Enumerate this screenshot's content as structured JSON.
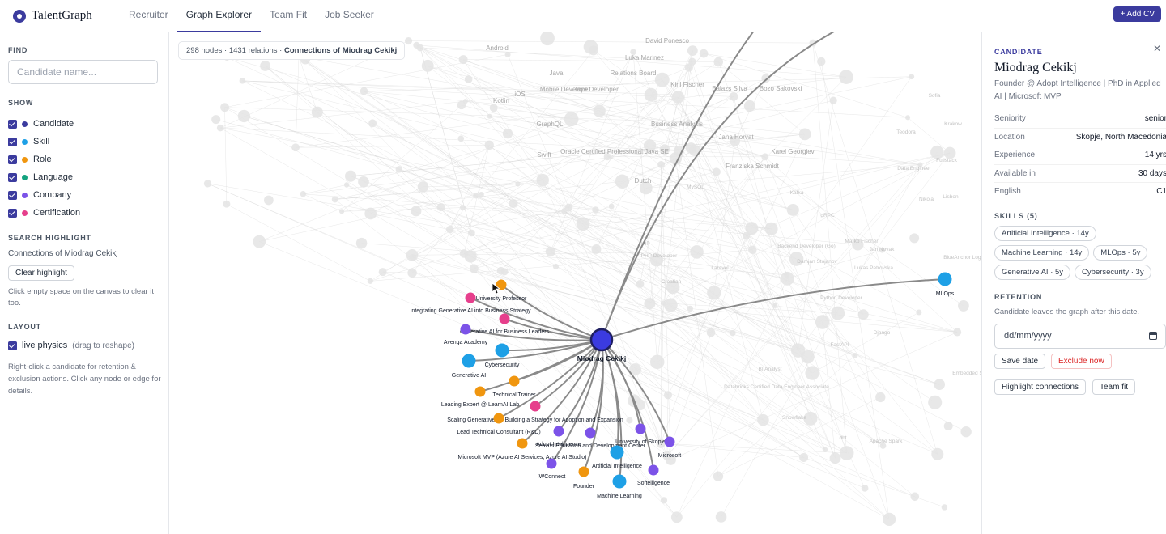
{
  "app": {
    "name": "TalentGraph"
  },
  "nav": {
    "tabs": [
      {
        "label": "Recruiter"
      },
      {
        "label": "Graph Explorer",
        "active": true
      },
      {
        "label": "Team Fit"
      },
      {
        "label": "Job Seeker"
      }
    ],
    "add_cv_label": "+ Add CV"
  },
  "sidebar": {
    "find_title": "FIND",
    "search_placeholder": "Candidate name...",
    "show_title": "SHOW",
    "filters": [
      {
        "label": "Candidate",
        "color": "#3b3b9e",
        "checked": true
      },
      {
        "label": "Skill",
        "color": "#1ea0e6",
        "checked": true
      },
      {
        "label": "Role",
        "color": "#f0960f",
        "checked": true
      },
      {
        "label": "Language",
        "color": "#14a37f",
        "checked": true
      },
      {
        "label": "Company",
        "color": "#7c53e8",
        "checked": true
      },
      {
        "label": "Certification",
        "color": "#e63f8c",
        "checked": true
      }
    ],
    "highlight_title": "SEARCH HIGHLIGHT",
    "highlight_text": "Connections of Miodrag Cekikj",
    "clear_label": "Clear highlight",
    "clear_hint": "Click empty space on the canvas to clear it too.",
    "layout_title": "LAYOUT",
    "physics_label": "live physics",
    "physics_hint": "(drag to reshape)",
    "help_text": "Right-click a candidate for retention & exclusion actions. Click any node or edge for details."
  },
  "canvas": {
    "stats_prefix": "298 nodes · 1431 relations · ",
    "stats_focus": "Connections of Miodrag Cekikj",
    "center": {
      "label": "Miodrag Cekikj"
    },
    "nodes": [
      {
        "label": "University Professor",
        "type": "role"
      },
      {
        "label": "Integrating Generative AI into Business Strategy",
        "type": "certification"
      },
      {
        "label": "Generative AI for Business Leaders",
        "type": "certification"
      },
      {
        "label": "Avenga Academy",
        "type": "company"
      },
      {
        "label": "Cybersecurity",
        "type": "skill"
      },
      {
        "label": "Generative AI",
        "type": "skill"
      },
      {
        "label": "Technical Trainer",
        "type": "role"
      },
      {
        "label": "Leading Expert @ LearnAI Lab",
        "type": "role"
      },
      {
        "label": "Scaling Generative AI: Building a Strategy for Adoption and Expansion",
        "type": "certification"
      },
      {
        "label": "Lead Technical Consultant (R&D)",
        "type": "role"
      },
      {
        "label": "Adopt Intelligence",
        "type": "company"
      },
      {
        "label": "Seavus Education and Development Center",
        "type": "company"
      },
      {
        "label": "University of Skopje",
        "type": "company"
      },
      {
        "label": "Microsoft MVP (Azure AI Services, Azure AI Studio)",
        "type": "role"
      },
      {
        "label": "Artificial Intelligence",
        "type": "skill"
      },
      {
        "label": "Microsoft",
        "type": "company"
      },
      {
        "label": "IWConnect",
        "type": "company"
      },
      {
        "label": "Founder",
        "type": "role"
      },
      {
        "label": "Softelligence",
        "type": "company"
      },
      {
        "label": "Machine Learning",
        "type": "skill"
      },
      {
        "label": "MLOps",
        "type": "skill"
      }
    ],
    "faded_labels": [
      "Android",
      "Java",
      "Relations Board",
      "David Ponesco",
      "Luka Marinez",
      "iOS",
      "Mobile Developer",
      "Java Developer",
      "Kiril Fischer",
      "Balazs Silva",
      "Bozo Sakovski",
      "Kotlin",
      "GraphQL",
      "Business Analysis",
      "Jana Horvat",
      "Karel Georgiev",
      "Swift",
      "Oracle Certified Professional Java SE",
      "Franziska Schmidt",
      "Dutch",
      "MySQL",
      "Kafka",
      "PHP",
      "PHP Developer",
      "gRPC",
      "Marko Fischer",
      "Laravel",
      "Croatian",
      "Jan Novak",
      "Lukas Petrovska",
      "Damjan Stojanov",
      "Python Developer",
      "BlueAnchor Logistic",
      "Django",
      "FastAPI",
      "BI Analyst",
      "Databricks Certified Data Engineer Associate",
      "Snowflake",
      "dbt",
      "Apache Spark",
      "Embedded S",
      "Backend Developer (Go)",
      "Nikola",
      "Data Engineer",
      "Lisbon",
      "Fullstack",
      "Teodora",
      "Krakow",
      "Sofia"
    ]
  },
  "panel": {
    "kicker": "CANDIDATE",
    "name": "Miodrag Cekikj",
    "headline": "Founder @ Adopt Intelligence | PhD in Applied AI | Microsoft MVP",
    "facts": [
      {
        "key": "Seniority",
        "value": "senior"
      },
      {
        "key": "Location",
        "value": "Skopje, North Macedonia"
      },
      {
        "key": "Experience",
        "value": "14 yrs"
      },
      {
        "key": "Available in",
        "value": "30 days"
      },
      {
        "key": "English",
        "value": "C1"
      }
    ],
    "skills_title": "SKILLS (5)",
    "skills": [
      "Artificial Intelligence · 14y",
      "Machine Learning · 14y",
      "MLOps · 5y",
      "Generative AI · 5y",
      "Cybersecurity · 3y"
    ],
    "retention_title": "RETENTION",
    "retention_text": "Candidate leaves the graph after this date.",
    "date_placeholder": "dd/mm/yyyy",
    "save_label": "Save date",
    "exclude_label": "Exclude now",
    "highlight_label": "Highlight connections",
    "teamfit_label": "Team fit"
  }
}
